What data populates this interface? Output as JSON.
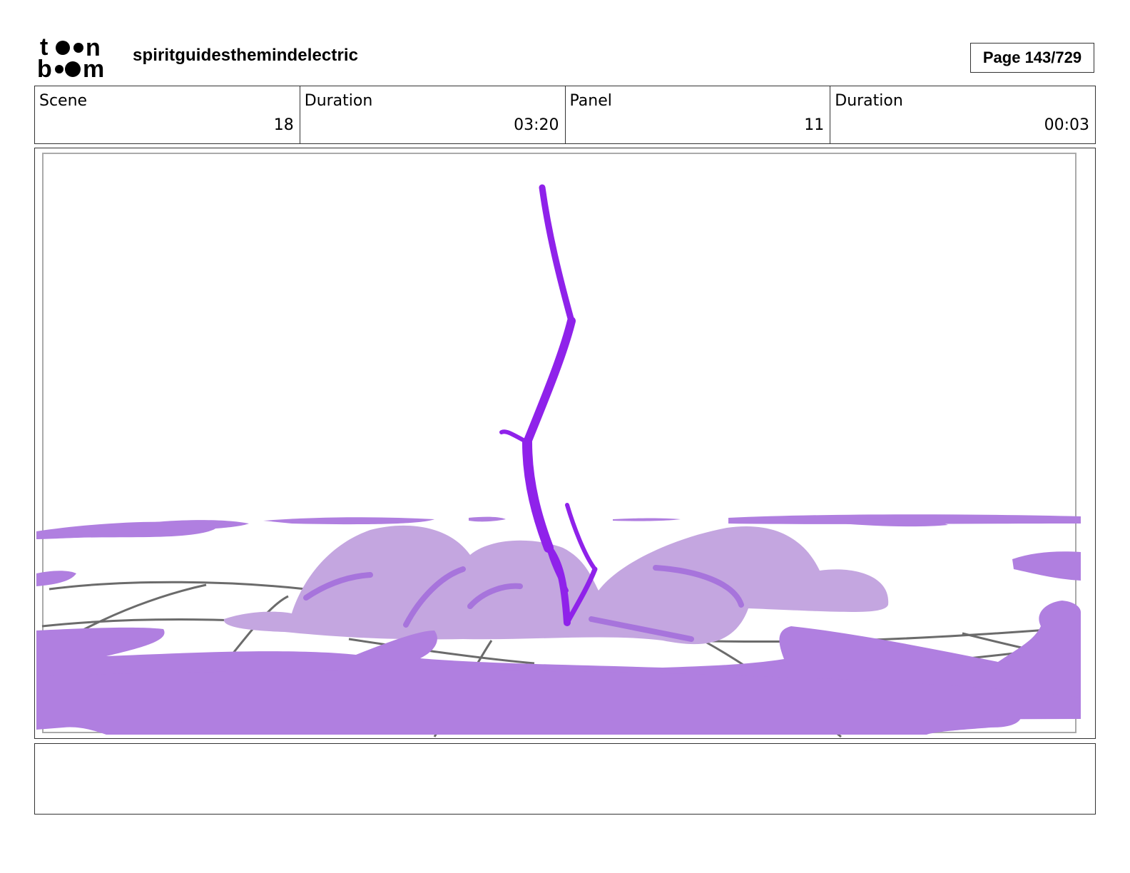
{
  "header": {
    "logo": {
      "line1": "toon",
      "line2": "boom",
      "icon": "toonboom-logo"
    },
    "project_title": "spiritguidesthemindelectric",
    "page_label": "Page 143/729"
  },
  "info": [
    {
      "label": "Scene",
      "value": "18"
    },
    {
      "label": "Duration",
      "value": "03:20"
    },
    {
      "label": "Panel",
      "value": "11"
    },
    {
      "label": "Duration",
      "value": "00:03"
    }
  ],
  "colors": {
    "ground_purple": "#b07fe0",
    "cloud_lilac": "#c4a6e0",
    "bolt_violet": "#8f22ea",
    "sketch_gray": "#6b6b6b"
  },
  "notes": {
    "text": ""
  }
}
